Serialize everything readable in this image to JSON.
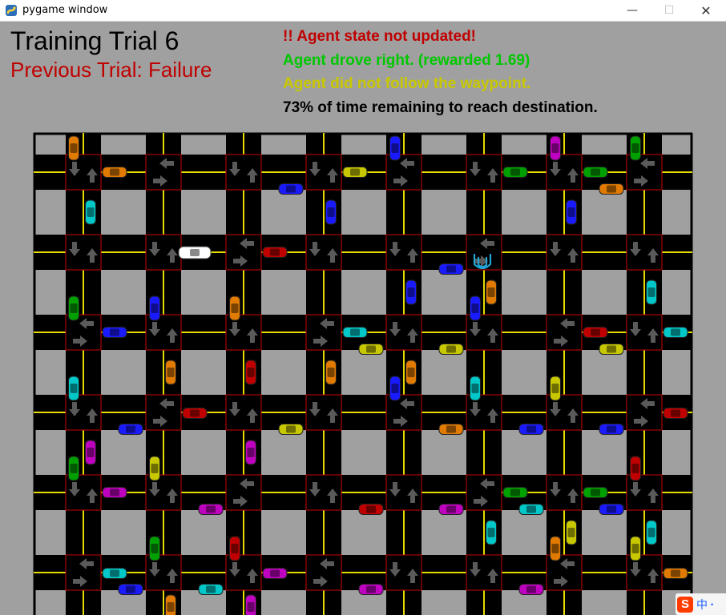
{
  "window": {
    "title": "pygame window",
    "minimize_glyph": "—",
    "maximize_glyph": "☐",
    "close_glyph": "✕"
  },
  "hud": {
    "trial_title": "Training Trial 6",
    "previous_trial": "Previous Trial: Failure",
    "state_message": "!! Agent state not updated!",
    "reward_message": "Agent drove right. (rewarded 1.69)",
    "waypoint_message": "Agent did not follow the waypoint.",
    "time_message": "73% of time remaining to reach destination."
  },
  "colors": {
    "background": "#a0a0a0",
    "road": "#000000",
    "lane_line": "#e6dc00",
    "stop_line": "#c80000",
    "arrow": "#5a5a5a",
    "failure_text": "#c00000",
    "reward_text": "#00c800",
    "waypoint_text": "#c8c800",
    "destination_marker": "#1fa6d6"
  },
  "icons": {
    "app": "pygame-snake-icon",
    "destination": "udacity-u-icon",
    "ime": "sogou-input-icon"
  },
  "ime": {
    "logo": "S",
    "label": "中",
    "dot": "•"
  }
}
